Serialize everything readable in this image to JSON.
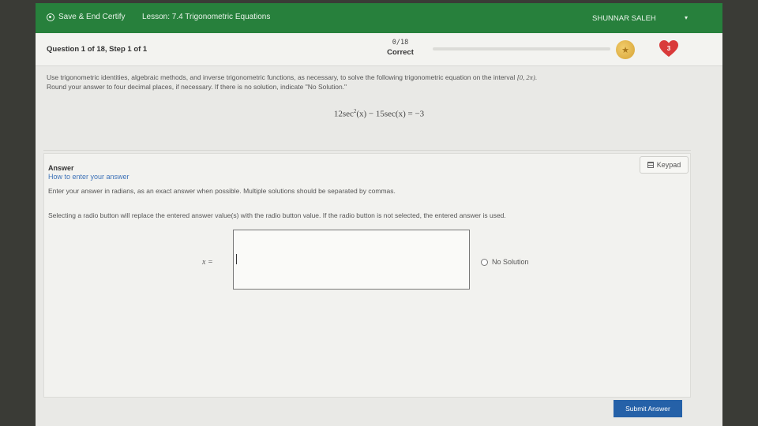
{
  "header": {
    "save_label": "Save & End Certify",
    "lesson": "Lesson: 7.4 Trigonometric Equations",
    "user": "SHUNNAR SALEH",
    "caret": "▾"
  },
  "status": {
    "question_label": "Question 1 of 18, Step 1 of 1",
    "score": "0/18",
    "result": "Correct",
    "progress": 0,
    "hearts": "3",
    "coin_symbol": "★"
  },
  "question": {
    "text_before": "Use trigonometric identities, algebraic methods, and inverse trigonometric functions, as necessary, to solve the following trigonometric equation on the interval ",
    "interval": "[0, 2π)",
    "text_after": ".",
    "line2": "Round your answer to four decimal places, if necessary. If there is no solution, indicate \"No Solution.\"",
    "eq_left": "12sec",
    "eq_exp": "2",
    "eq_right": "(x) − 15sec(x) = −3"
  },
  "answer": {
    "title": "Answer",
    "howto": "How to enter your answer",
    "instructions": "Enter your answer in radians, as an exact answer when possible. Multiple solutions should be separated by commas.",
    "radio_note": "Selecting a radio button will replace the entered answer value(s) with the radio button value. If the radio button is not selected, the entered answer is used.",
    "keypad_label": "Keypad",
    "x_label": "x =",
    "input_value": "",
    "no_solution_label": "No Solution",
    "submit_label": "Submit Answer"
  },
  "colors": {
    "header_green": "#27803c",
    "submit_blue": "#2561a8",
    "heart_red": "#d93a3a",
    "coin_gold": "#e4b54c",
    "link_blue": "#3d72b8"
  }
}
